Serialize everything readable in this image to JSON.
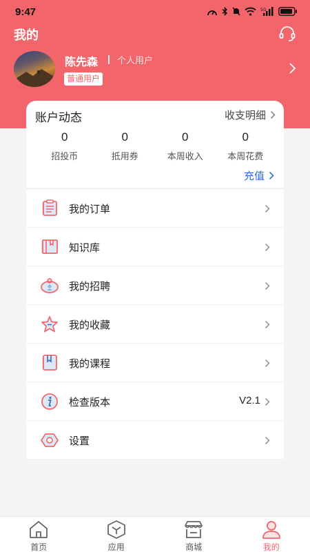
{
  "status_bar": {
    "time": "9:47",
    "icons": [
      "speed-icon",
      "bluetooth-icon",
      "mute-icon",
      "wifi-icon",
      "signal-icon",
      "battery-icon"
    ]
  },
  "header": {
    "title": "我的",
    "service_icon": "headset-icon"
  },
  "profile": {
    "name": "陈先森",
    "account_type": "个人用户",
    "badge": "普通用户"
  },
  "account": {
    "title": "账户动态",
    "details_link": "收支明细",
    "stats": [
      {
        "value": "0",
        "label": "招投币"
      },
      {
        "value": "0",
        "label": "抵用券"
      },
      {
        "value": "0",
        "label": "本周收入"
      },
      {
        "value": "0",
        "label": "本周花费"
      }
    ],
    "recharge": "充值"
  },
  "menu": [
    {
      "label": "我的订单",
      "icon": "clipboard-icon",
      "value": ""
    },
    {
      "label": "知识库",
      "icon": "book-icon",
      "value": ""
    },
    {
      "label": "我的招聘",
      "icon": "recruit-icon",
      "value": ""
    },
    {
      "label": "我的收藏",
      "icon": "star-icon",
      "value": ""
    },
    {
      "label": "我的课程",
      "icon": "course-icon",
      "value": ""
    },
    {
      "label": "检查版本",
      "icon": "info-icon",
      "value": "V2.1"
    },
    {
      "label": "设置",
      "icon": "settings-icon",
      "value": ""
    }
  ],
  "tabbar": [
    {
      "label": "首页",
      "icon": "home-icon",
      "active": false
    },
    {
      "label": "应用",
      "icon": "apps-icon",
      "active": false
    },
    {
      "label": "商城",
      "icon": "store-icon",
      "active": false
    },
    {
      "label": "我的",
      "icon": "profile-icon",
      "active": true
    }
  ],
  "colors": {
    "brand": "#f2656b",
    "link": "#2b6fd6",
    "background": "#f4f4f4"
  }
}
